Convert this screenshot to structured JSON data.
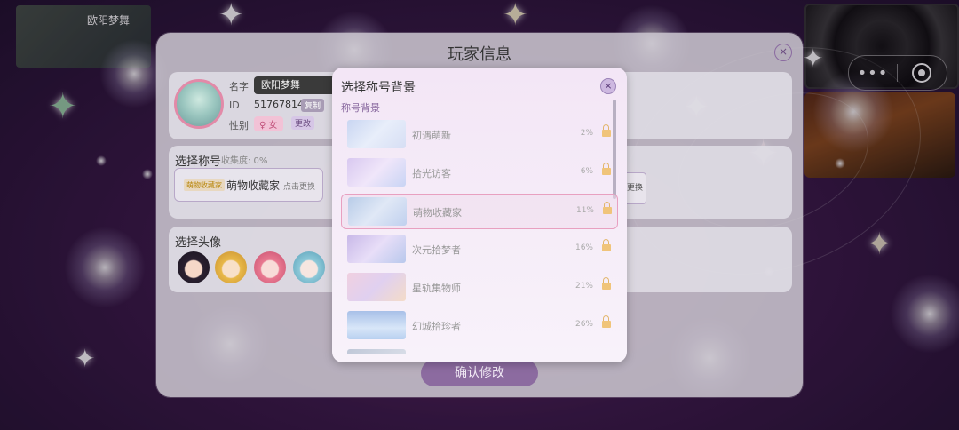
{
  "background": {
    "top_left_title": "欧阳梦舞"
  },
  "capsule": {
    "more_glyph": "•••",
    "target_icon": "target-icon"
  },
  "panel": {
    "title": "玩家信息",
    "close_glyph": "×",
    "profile": {
      "name_label": "名字",
      "name_value": "欧阳梦舞",
      "id_label": "ID",
      "id_value": "51767814",
      "copy_label": "复制",
      "gender_label": "性别",
      "gender_value": "♀ 女",
      "change_label": "更改"
    },
    "title_section": {
      "heading": "选择称号",
      "collect_rate": "收集度: 0%",
      "badge": "萌物收藏家",
      "current_title": "萌物收藏家",
      "tap_to_change": "点击更换",
      "right_change": "更换"
    },
    "avatar_section": {
      "heading": "选择头像"
    },
    "confirm_label": "确认修改"
  },
  "modal": {
    "title": "选择称号背景",
    "close_glyph": "×",
    "subtitle": "称号背景",
    "items": [
      {
        "name": "初遇萌新",
        "pct": "2%",
        "selected": false
      },
      {
        "name": "拾光访客",
        "pct": "6%",
        "selected": false
      },
      {
        "name": "萌物收藏家",
        "pct": "11%",
        "selected": true
      },
      {
        "name": "次元拾梦者",
        "pct": "16%",
        "selected": false
      },
      {
        "name": "星轨集物师",
        "pct": "21%",
        "selected": false
      },
      {
        "name": "幻城拾珍者",
        "pct": "26%",
        "selected": false
      }
    ]
  },
  "colors": {
    "accent_purple": "#8c6ba0",
    "selected_border": "#e8a0c0",
    "lock_gold": "#f0c47a"
  }
}
